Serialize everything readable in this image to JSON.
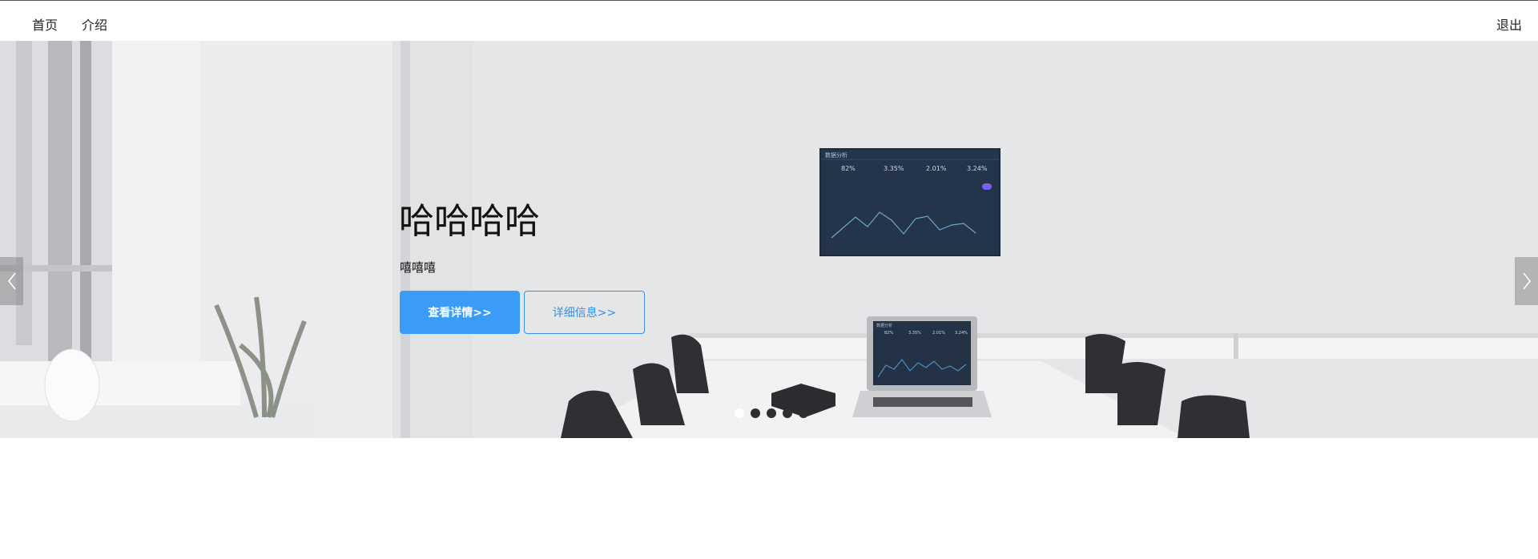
{
  "nav": {
    "home": "首页",
    "intro": "介绍",
    "logout": "退出"
  },
  "hero": {
    "title": "哈哈哈哈",
    "subtitle": "嘻嘻嘻",
    "primary_button": "查看详情>>",
    "secondary_button": "详细信息>>",
    "dots_count": 5,
    "active_dot": 0
  },
  "monitor": {
    "title": "数据分析",
    "stats": [
      "82%",
      "3.35%",
      "2.01%",
      "3.24%"
    ],
    "series": [
      12,
      18,
      25,
      16,
      30,
      22,
      14,
      26,
      28,
      20,
      24,
      27,
      18
    ]
  },
  "laptop": {
    "title": "数据分析",
    "stats": [
      "82%",
      "3.35%",
      "2.01%",
      "3.24%"
    ]
  },
  "colors": {
    "primary": "#3a9cf6",
    "outline": "#3a8fe8",
    "dot_active": "#ffffff",
    "dot_inactive": "#2e2f33"
  }
}
